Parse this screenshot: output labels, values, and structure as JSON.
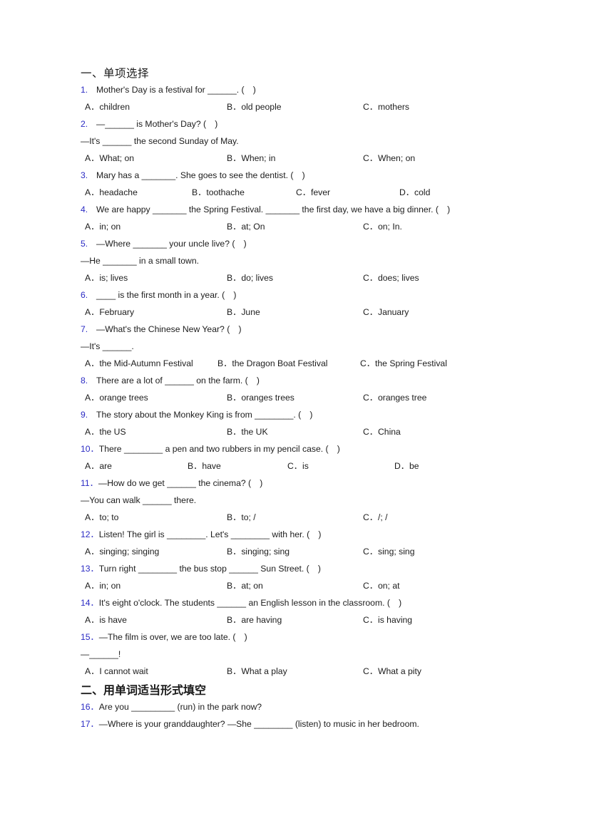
{
  "document": {
    "background_color": "#ffffff",
    "text_color": "#1c1c1c",
    "number_color": "#2b2bc4"
  },
  "sections": [
    {
      "heading": "一、单项选择",
      "bold": false
    },
    {
      "heading": "二、用单词适当形式填空",
      "bold": true
    }
  ],
  "questions": [
    {
      "num": "1.",
      "text": "Mother's Day is a festival for ______. (　)",
      "options": [
        "A．children",
        "B．old people",
        "C．mothers"
      ]
    },
    {
      "num": "2.",
      "text": "—______ is Mother's Day? (　)",
      "cont": "—It's ______ the second Sunday of May.",
      "options": [
        "A．What; on",
        "B．When; in",
        "C．When; on"
      ]
    },
    {
      "num": "3.",
      "text": "Mary has a _______. She goes to see the dentist. (　)",
      "options": [
        "A．headache",
        "B．toothache",
        "C．fever",
        "D．cold"
      ]
    },
    {
      "num": "4.",
      "text": "We are happy _______ the Spring Festival. _______ the first day, we have a big dinner. (　)",
      "options": [
        "A．in; on",
        "B．at; On",
        "C．on; In."
      ]
    },
    {
      "num": "5.",
      "text": "—Where _______ your uncle live? (　)",
      "cont": "—He _______ in a small town.",
      "options": [
        "A．is; lives",
        "B．do; lives",
        "C．does; lives"
      ]
    },
    {
      "num": "6.",
      "text": "____ is the first month in a year. (　)",
      "options": [
        "A．February",
        "B．June",
        "C．January"
      ]
    },
    {
      "num": "7.",
      "text": "—What's the Chinese New Year? (　)",
      "cont": "—It's ______.",
      "options": [
        "A．the Mid-Autumn Festival",
        "B．the Dragon Boat Festival",
        "C．the Spring Festival"
      ]
    },
    {
      "num": "8.",
      "text": "There are a lot of ______ on the farm. (　)",
      "options": [
        "A．orange trees",
        "B．oranges trees",
        "C．oranges tree"
      ]
    },
    {
      "num": "9.",
      "text": "The story about the Monkey King is from ________. (　)",
      "options": [
        "A．the US",
        "B．the UK",
        "C．China"
      ]
    },
    {
      "num": "10．",
      "text": "There ________ a pen and two rubbers in my pencil case. (　)",
      "options": [
        "A．are",
        "B．have",
        "C．is",
        "D．be"
      ]
    },
    {
      "num": "11．",
      "text": "—How do we get ______ the cinema? (　)",
      "cont": "—You can walk ______ there.",
      "options": [
        "A．to; to",
        "B．to; /",
        "C．/; /"
      ]
    },
    {
      "num": "12．",
      "text": "Listen! The girl is ________. Let's ________ with her. (　)",
      "options": [
        "A．singing; singing",
        "B．singing; sing",
        "C．sing; sing"
      ]
    },
    {
      "num": "13．",
      "text": "Turn right ________ the bus stop ______ Sun Street. (　)",
      "options": [
        "A．in; on",
        "B．at; on",
        "C．on; at"
      ]
    },
    {
      "num": "14．",
      "text": "It's eight o'clock. The students ______ an English lesson in the classroom. (　)",
      "options": [
        "A．is have",
        "B．are having",
        "C．is having"
      ]
    },
    {
      "num": "15．",
      "text": "—The film is over, we are too late. (　)",
      "cont": "—______!",
      "options": [
        "A．I cannot wait",
        "B．What a play",
        "C．What a pity"
      ]
    },
    {
      "num": "16．",
      "text": "Are you _________ (run) in the park now?"
    },
    {
      "num": "17．",
      "text": "—Where is your granddaughter?  —She ________ (listen) to music in her bedroom."
    }
  ]
}
